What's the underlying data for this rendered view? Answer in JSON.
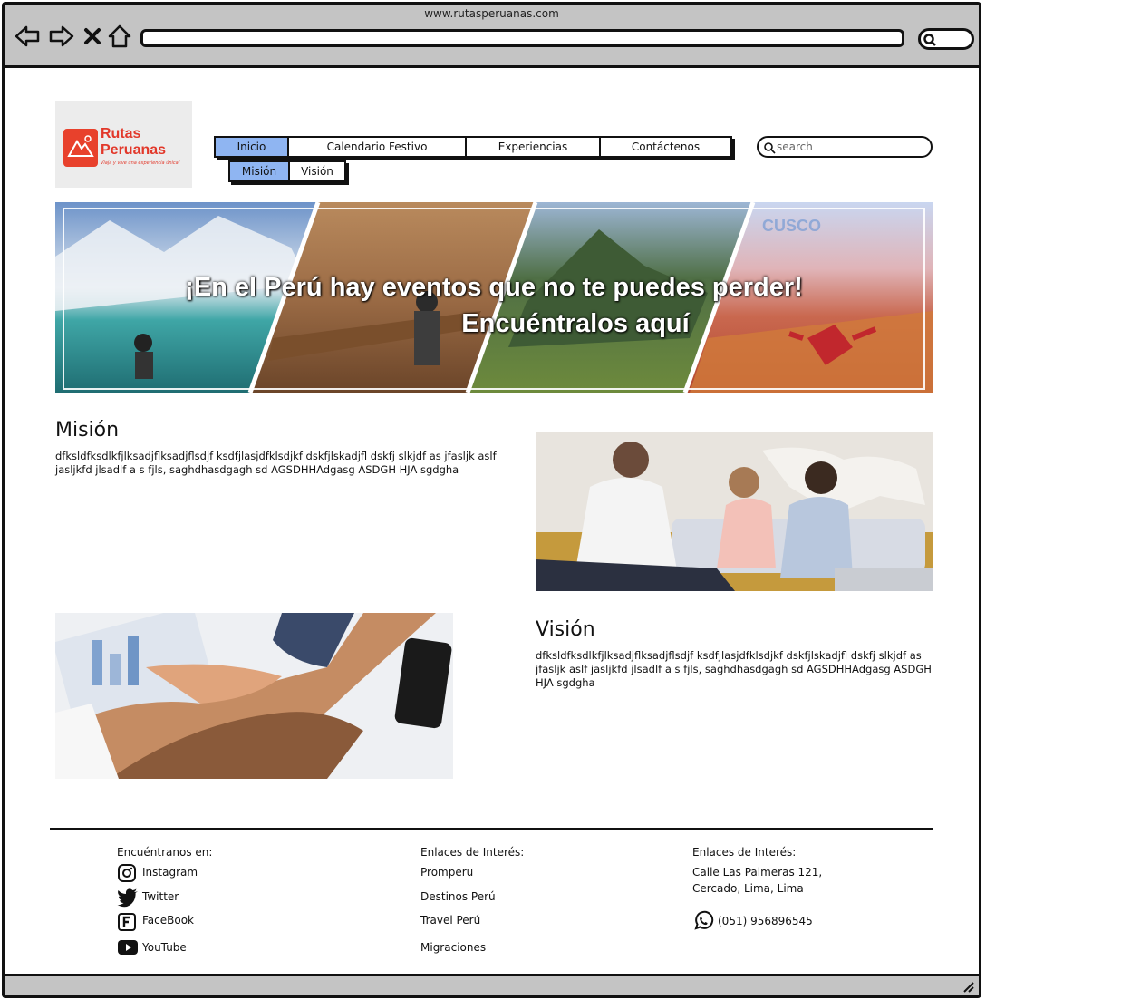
{
  "browser": {
    "url": "www.rutasperuanas.com"
  },
  "logo": {
    "line1": "Rutas",
    "line2": "Peruanas",
    "tagline": "Viaja y vive una experiencia única!"
  },
  "nav": {
    "items": [
      {
        "label": "Inicio",
        "active": true
      },
      {
        "label": "Calendario Festivo",
        "active": false
      },
      {
        "label": "Experiencias",
        "active": false
      },
      {
        "label": "Contáctenos",
        "active": false
      }
    ],
    "sub_items": [
      {
        "label": "Misión",
        "active": true
      },
      {
        "label": "Visión",
        "active": false
      }
    ]
  },
  "search": {
    "placeholder": "search"
  },
  "banner": {
    "line1": "¡En el Perú hay eventos que no te puedes perder!",
    "line2": "Encuéntralos aquí",
    "watermark": "CUSCO"
  },
  "mision": {
    "title": "Misión",
    "body": "dfksldfksdlkfjlksadjflksadjflsdjf ksdfjlasjdfklsdjkf dskfjlskadjfl dskfj slkjdf as jfasljk aslf jasljkfd jlsadlf a s fjls, saghdhasdgagh sd AGSDHHAdgasg ASDGH HJA sgdgha"
  },
  "vision": {
    "title": "Visión",
    "body": "dfksldfksdlkfjlksadjflksadjflsdjf ksdfjlasjdfklsdjkf dskfjlskadjfl dskfj slkjdf as jfasljk aslf jasljkfd jlsadlf a s fjls, saghdhasdgagh sd AGSDHHAdgasg ASDGH HJA sgdgha"
  },
  "footer": {
    "social": {
      "heading": "Encuéntranos en:",
      "items": [
        {
          "label": "Instagram",
          "icon": "instagram-icon"
        },
        {
          "label": "Twitter",
          "icon": "twitter-icon"
        },
        {
          "label": "FaceBook",
          "icon": "facebook-icon"
        },
        {
          "label": "YouTube",
          "icon": "youtube-icon"
        }
      ]
    },
    "links": {
      "heading": "Enlaces de Interés:",
      "items": [
        "Promperu",
        "Destinos Perú",
        "Travel Perú",
        "Migraciones"
      ]
    },
    "contact": {
      "heading": "Enlaces de Interés:",
      "address_line1": "Calle Las Palmeras 121,",
      "address_line2": "Cercado, Lima, Lima",
      "phone": "(051) 956896545",
      "phone_icon": "whatsapp-icon"
    }
  },
  "colors": {
    "active_tab": "#8fb5f2",
    "brand_red": "#e2382a",
    "chrome_gray": "#c4c4c4"
  }
}
